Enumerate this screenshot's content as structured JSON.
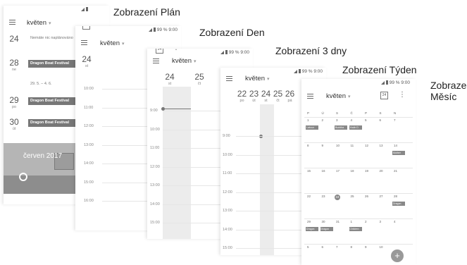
{
  "titles": {
    "plan": "Zobrazení Plán",
    "day": "Zobrazení Den",
    "three_day": "Zobrazení 3 dny",
    "week": "Zobrazení Týden",
    "month_line1": "Zobrazení",
    "month_line2": "Měsíc"
  },
  "status": {
    "battery": "99 %",
    "time": "9:00"
  },
  "month_label": "květen",
  "calendar_icon_day": "24",
  "plan": {
    "rows": [
      {
        "num": "24",
        "dow": "",
        "text": "Nemáte nic naplánováno"
      },
      {
        "num": "28",
        "dow": "ne",
        "event": "Dragon Boat Festival"
      },
      {
        "range": "29. 5. – 4. 6."
      },
      {
        "num": "29",
        "dow": "po",
        "event": "Dragon Boat Festival"
      },
      {
        "num": "30",
        "dow": "út",
        "event": "Dragon Boat Festival"
      }
    ],
    "banner": "červen 2017",
    "hours": [
      "10:00",
      "11:00",
      "12:00",
      "13:00",
      "14:00",
      "15:00",
      "16:00"
    ]
  },
  "day": {
    "num": "24",
    "dow": "st",
    "hours": [
      "10:00",
      "11:00",
      "12:00",
      "13:00",
      "14:00",
      "15:00",
      "16:00"
    ]
  },
  "three_day": {
    "days": [
      {
        "num": "24",
        "dow": "st"
      },
      {
        "num": "25",
        "dow": "čt"
      }
    ],
    "hours": [
      "9:00",
      "10:00",
      "11:00",
      "12:00",
      "13:00",
      "14:00",
      "15:00"
    ]
  },
  "week": {
    "days": [
      {
        "num": "22",
        "dow": "po"
      },
      {
        "num": "23",
        "dow": "út"
      },
      {
        "num": "24",
        "dow": "st"
      },
      {
        "num": "25",
        "dow": "čt"
      },
      {
        "num": "26",
        "dow": "pá"
      }
    ],
    "hours": [
      "9:00",
      "10:00",
      "11:00",
      "12:00",
      "13:00",
      "14:00",
      "15:00"
    ]
  },
  "monthview": {
    "weekdays": [
      "P",
      "Ú",
      "S",
      "Č",
      "P",
      "S",
      "N"
    ],
    "weeks": [
      [
        "1",
        "2",
        "3",
        "4",
        "5",
        "6",
        "7"
      ],
      [
        "8",
        "9",
        "10",
        "11",
        "12",
        "13",
        "14"
      ],
      [
        "15",
        "16",
        "17",
        "18",
        "19",
        "20",
        "21"
      ],
      [
        "22",
        "23",
        "24",
        "25",
        "26",
        "27",
        "28"
      ],
      [
        "29",
        "30",
        "31",
        "1",
        "2",
        "3",
        "4"
      ],
      [
        "5",
        "6",
        "7",
        "8",
        "9",
        "10",
        ""
      ]
    ],
    "events": [
      {
        "label": "Labour",
        "week": 0,
        "col": 0
      },
      {
        "label": "Buddha",
        "week": 0,
        "col": 2
      },
      {
        "label": "Youth D",
        "week": 0,
        "col": 3
      },
      {
        "label": "Mother",
        "week": 1,
        "col": 6
      },
      {
        "label": "Dragon",
        "week": 3,
        "col": 6
      },
      {
        "label": "Dragon",
        "week": 4,
        "col": 0
      },
      {
        "label": "Dragon",
        "week": 4,
        "col": 1
      },
      {
        "label": "Children",
        "week": 4,
        "col": 3
      }
    ],
    "fab": "+"
  }
}
